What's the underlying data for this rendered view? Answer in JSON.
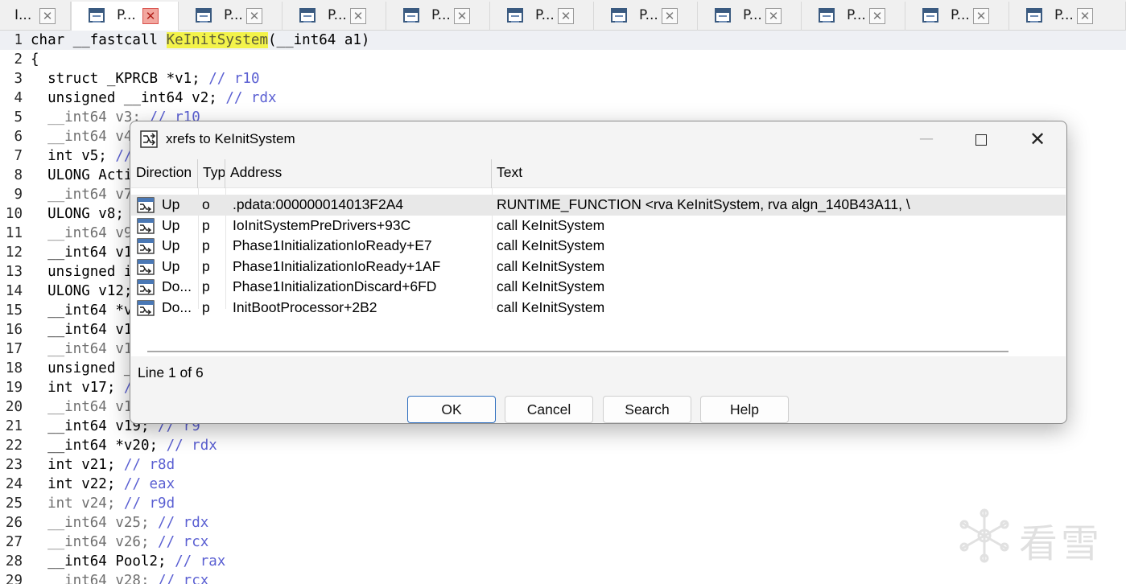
{
  "tabs": [
    {
      "label": "I..."
    },
    {
      "label": "P..."
    },
    {
      "label": "P..."
    },
    {
      "label": "P..."
    },
    {
      "label": "P..."
    },
    {
      "label": "P..."
    },
    {
      "label": "P..."
    },
    {
      "label": "P..."
    },
    {
      "label": "P..."
    },
    {
      "label": "P..."
    },
    {
      "label": "P..."
    }
  ],
  "tab_close_glyph": "✕",
  "code": {
    "lines": [
      {
        "num": "1",
        "parts": [
          {
            "t": "char __fastcall "
          },
          {
            "t": "KeInitSystem",
            "c": "hl"
          },
          {
            "t": "(__int64 a1)"
          }
        ]
      },
      {
        "num": "2",
        "parts": [
          {
            "t": "{"
          }
        ]
      },
      {
        "num": "3",
        "parts": [
          {
            "t": "  struct _KPRCB *v1; "
          },
          {
            "t": "// r10",
            "c": "cmt"
          }
        ]
      },
      {
        "num": "4",
        "parts": [
          {
            "t": "  unsigned __int64 v2; "
          },
          {
            "t": "// rdx",
            "c": "cmt"
          }
        ]
      },
      {
        "num": "5",
        "parts": [
          {
            "t": "  __int64 v3; ",
            "c": "dim"
          },
          {
            "t": "// r10",
            "c": "cmt"
          }
        ]
      },
      {
        "num": "6",
        "parts": [
          {
            "t": "  __int64 v4",
            "c": "dim"
          }
        ]
      },
      {
        "num": "7",
        "parts": [
          {
            "t": "  int v5; "
          },
          {
            "t": "//",
            "c": "cmt"
          }
        ]
      },
      {
        "num": "8",
        "parts": [
          {
            "t": "  ULONG Acti"
          }
        ]
      },
      {
        "num": "9",
        "parts": [
          {
            "t": "  __int64 v7",
            "c": "dim"
          }
        ]
      },
      {
        "num": "10",
        "parts": [
          {
            "t": "  ULONG v8;"
          }
        ]
      },
      {
        "num": "11",
        "parts": [
          {
            "t": "  __int64 v9",
            "c": "dim"
          }
        ]
      },
      {
        "num": "12",
        "parts": [
          {
            "t": "  __int64 v1"
          }
        ]
      },
      {
        "num": "13",
        "parts": [
          {
            "t": "  unsigned i"
          }
        ]
      },
      {
        "num": "14",
        "parts": [
          {
            "t": "  ULONG v12;"
          }
        ]
      },
      {
        "num": "15",
        "parts": [
          {
            "t": "  __int64 *v"
          }
        ]
      },
      {
        "num": "16",
        "parts": [
          {
            "t": "  __int64 v1"
          }
        ]
      },
      {
        "num": "17",
        "parts": [
          {
            "t": "  __int64 v1",
            "c": "dim"
          }
        ]
      },
      {
        "num": "18",
        "parts": [
          {
            "t": "  unsigned _"
          }
        ]
      },
      {
        "num": "19",
        "parts": [
          {
            "t": "  int v17; "
          },
          {
            "t": "/",
            "c": "cmt"
          }
        ]
      },
      {
        "num": "20",
        "parts": [
          {
            "t": "  __int64 v1",
            "c": "dim"
          }
        ]
      },
      {
        "num": "21",
        "parts": [
          {
            "t": "  __int64 v19; "
          },
          {
            "t": "// r9",
            "c": "cmt"
          }
        ]
      },
      {
        "num": "22",
        "parts": [
          {
            "t": "  __int64 *v20; "
          },
          {
            "t": "// rdx",
            "c": "cmt"
          }
        ]
      },
      {
        "num": "23",
        "parts": [
          {
            "t": "  int v21; "
          },
          {
            "t": "// r8d",
            "c": "cmt"
          }
        ]
      },
      {
        "num": "24",
        "parts": [
          {
            "t": "  int v22; "
          },
          {
            "t": "// eax",
            "c": "cmt"
          }
        ]
      },
      {
        "num": "25",
        "parts": [
          {
            "t": "  int v24; ",
            "c": "dim"
          },
          {
            "t": "// r9d",
            "c": "cmt"
          }
        ]
      },
      {
        "num": "26",
        "parts": [
          {
            "t": "  __int64 v25; ",
            "c": "dim"
          },
          {
            "t": "// rdx",
            "c": "cmt"
          }
        ]
      },
      {
        "num": "27",
        "parts": [
          {
            "t": "  __int64 v26; ",
            "c": "dim"
          },
          {
            "t": "// rcx",
            "c": "cmt"
          }
        ]
      },
      {
        "num": "28",
        "parts": [
          {
            "t": "  __int64 Pool2; "
          },
          {
            "t": "// rax",
            "c": "cmt"
          }
        ]
      },
      {
        "num": "29",
        "parts": [
          {
            "t": "  __int64 v28; ",
            "c": "dim"
          },
          {
            "t": "// rcx",
            "c": "cmt"
          }
        ]
      }
    ]
  },
  "dialog": {
    "title": "xrefs to KeInitSystem",
    "minimize_glyph": "—",
    "close_glyph": "✕",
    "columns": [
      "Direction",
      "Type",
      "Address",
      "Text"
    ],
    "rows": [
      {
        "direction": "Up",
        "type": "o",
        "address": ".pdata:000000014013F2A4",
        "text": "RUNTIME_FUNCTION <rva KeInitSystem, rva algn_140B43A11, \\"
      },
      {
        "direction": "Up",
        "type": "p",
        "address": "IoInitSystemPreDrivers+93C",
        "text": "call    KeInitSystem"
      },
      {
        "direction": "Up",
        "type": "p",
        "address": "Phase1InitializationIoReady+E7",
        "text": "call    KeInitSystem"
      },
      {
        "direction": "Up",
        "type": "p",
        "address": "Phase1InitializationIoReady+1AF",
        "text": "call    KeInitSystem"
      },
      {
        "direction": "Do...",
        "type": "p",
        "address": "Phase1InitializationDiscard+6FD",
        "text": "call    KeInitSystem"
      },
      {
        "direction": "Do...",
        "type": "p",
        "address": "InitBootProcessor+2B2",
        "text": "call    KeInitSystem"
      }
    ],
    "status": "Line 1 of 6",
    "buttons": {
      "ok": "OK",
      "cancel": "Cancel",
      "search": "Search",
      "help": "Help"
    }
  },
  "watermark": {
    "text": "看雪"
  }
}
